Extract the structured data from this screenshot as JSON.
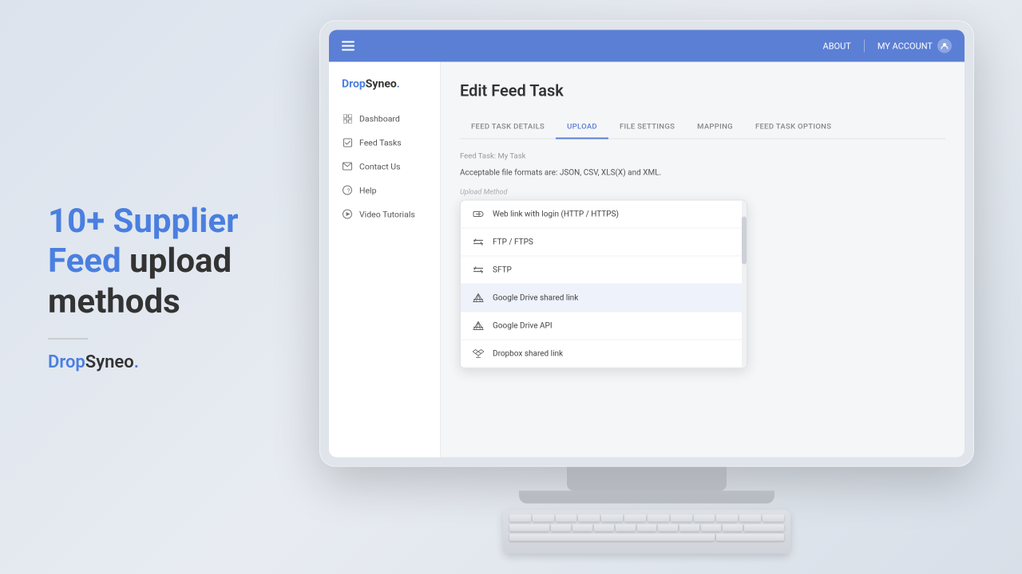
{
  "marketing": {
    "title_line1": "10+ Supplier",
    "title_highlight1": "Feed",
    "title_line2": " upload",
    "title_line3": "methods",
    "logo": {
      "drop": "Drop",
      "syneo": "Syneo",
      "dot": "."
    }
  },
  "header": {
    "about_label": "ABOUT",
    "my_account_label": "MY ACCOUNT"
  },
  "sidebar": {
    "logo": {
      "drop": "Drop",
      "syneo": "Syneo",
      "dot": "."
    },
    "items": [
      {
        "label": "Dashboard",
        "icon": "grid-icon"
      },
      {
        "label": "Feed Tasks",
        "icon": "check-square-icon"
      },
      {
        "label": "Contact Us",
        "icon": "mail-icon"
      },
      {
        "label": "Help",
        "icon": "help-circle-icon"
      },
      {
        "label": "Video Tutorials",
        "icon": "play-circle-icon"
      }
    ]
  },
  "page": {
    "title": "Edit Feed Task",
    "tabs": [
      {
        "label": "FEED TASK DETAILS",
        "active": false
      },
      {
        "label": "UPLOAD",
        "active": true
      },
      {
        "label": "FILE SETTINGS",
        "active": false
      },
      {
        "label": "MAPPING",
        "active": false
      },
      {
        "label": "FEED TASK OPTIONS",
        "active": false
      }
    ],
    "breadcrumb": "Feed Task: My Task",
    "file_formats_text": "Acceptable file formats are: JSON, CSV, XLS(X) and XML.",
    "upload_section": {
      "label": "Upload Method",
      "dropdown": {
        "items": [
          {
            "label": "Web link with login (HTTP / HTTPS)",
            "icon": "link-icon",
            "selected": false
          },
          {
            "label": "FTP / FTPS",
            "icon": "ftp-icon",
            "selected": false
          },
          {
            "label": "SFTP",
            "icon": "sftp-icon",
            "selected": false
          },
          {
            "label": "Google Drive shared link",
            "icon": "gdrive-icon",
            "selected": true
          },
          {
            "label": "Google Drive API",
            "icon": "gdrive-icon",
            "selected": false
          },
          {
            "label": "Dropbox shared link",
            "icon": "dropbox-icon",
            "selected": false
          }
        ]
      }
    }
  }
}
